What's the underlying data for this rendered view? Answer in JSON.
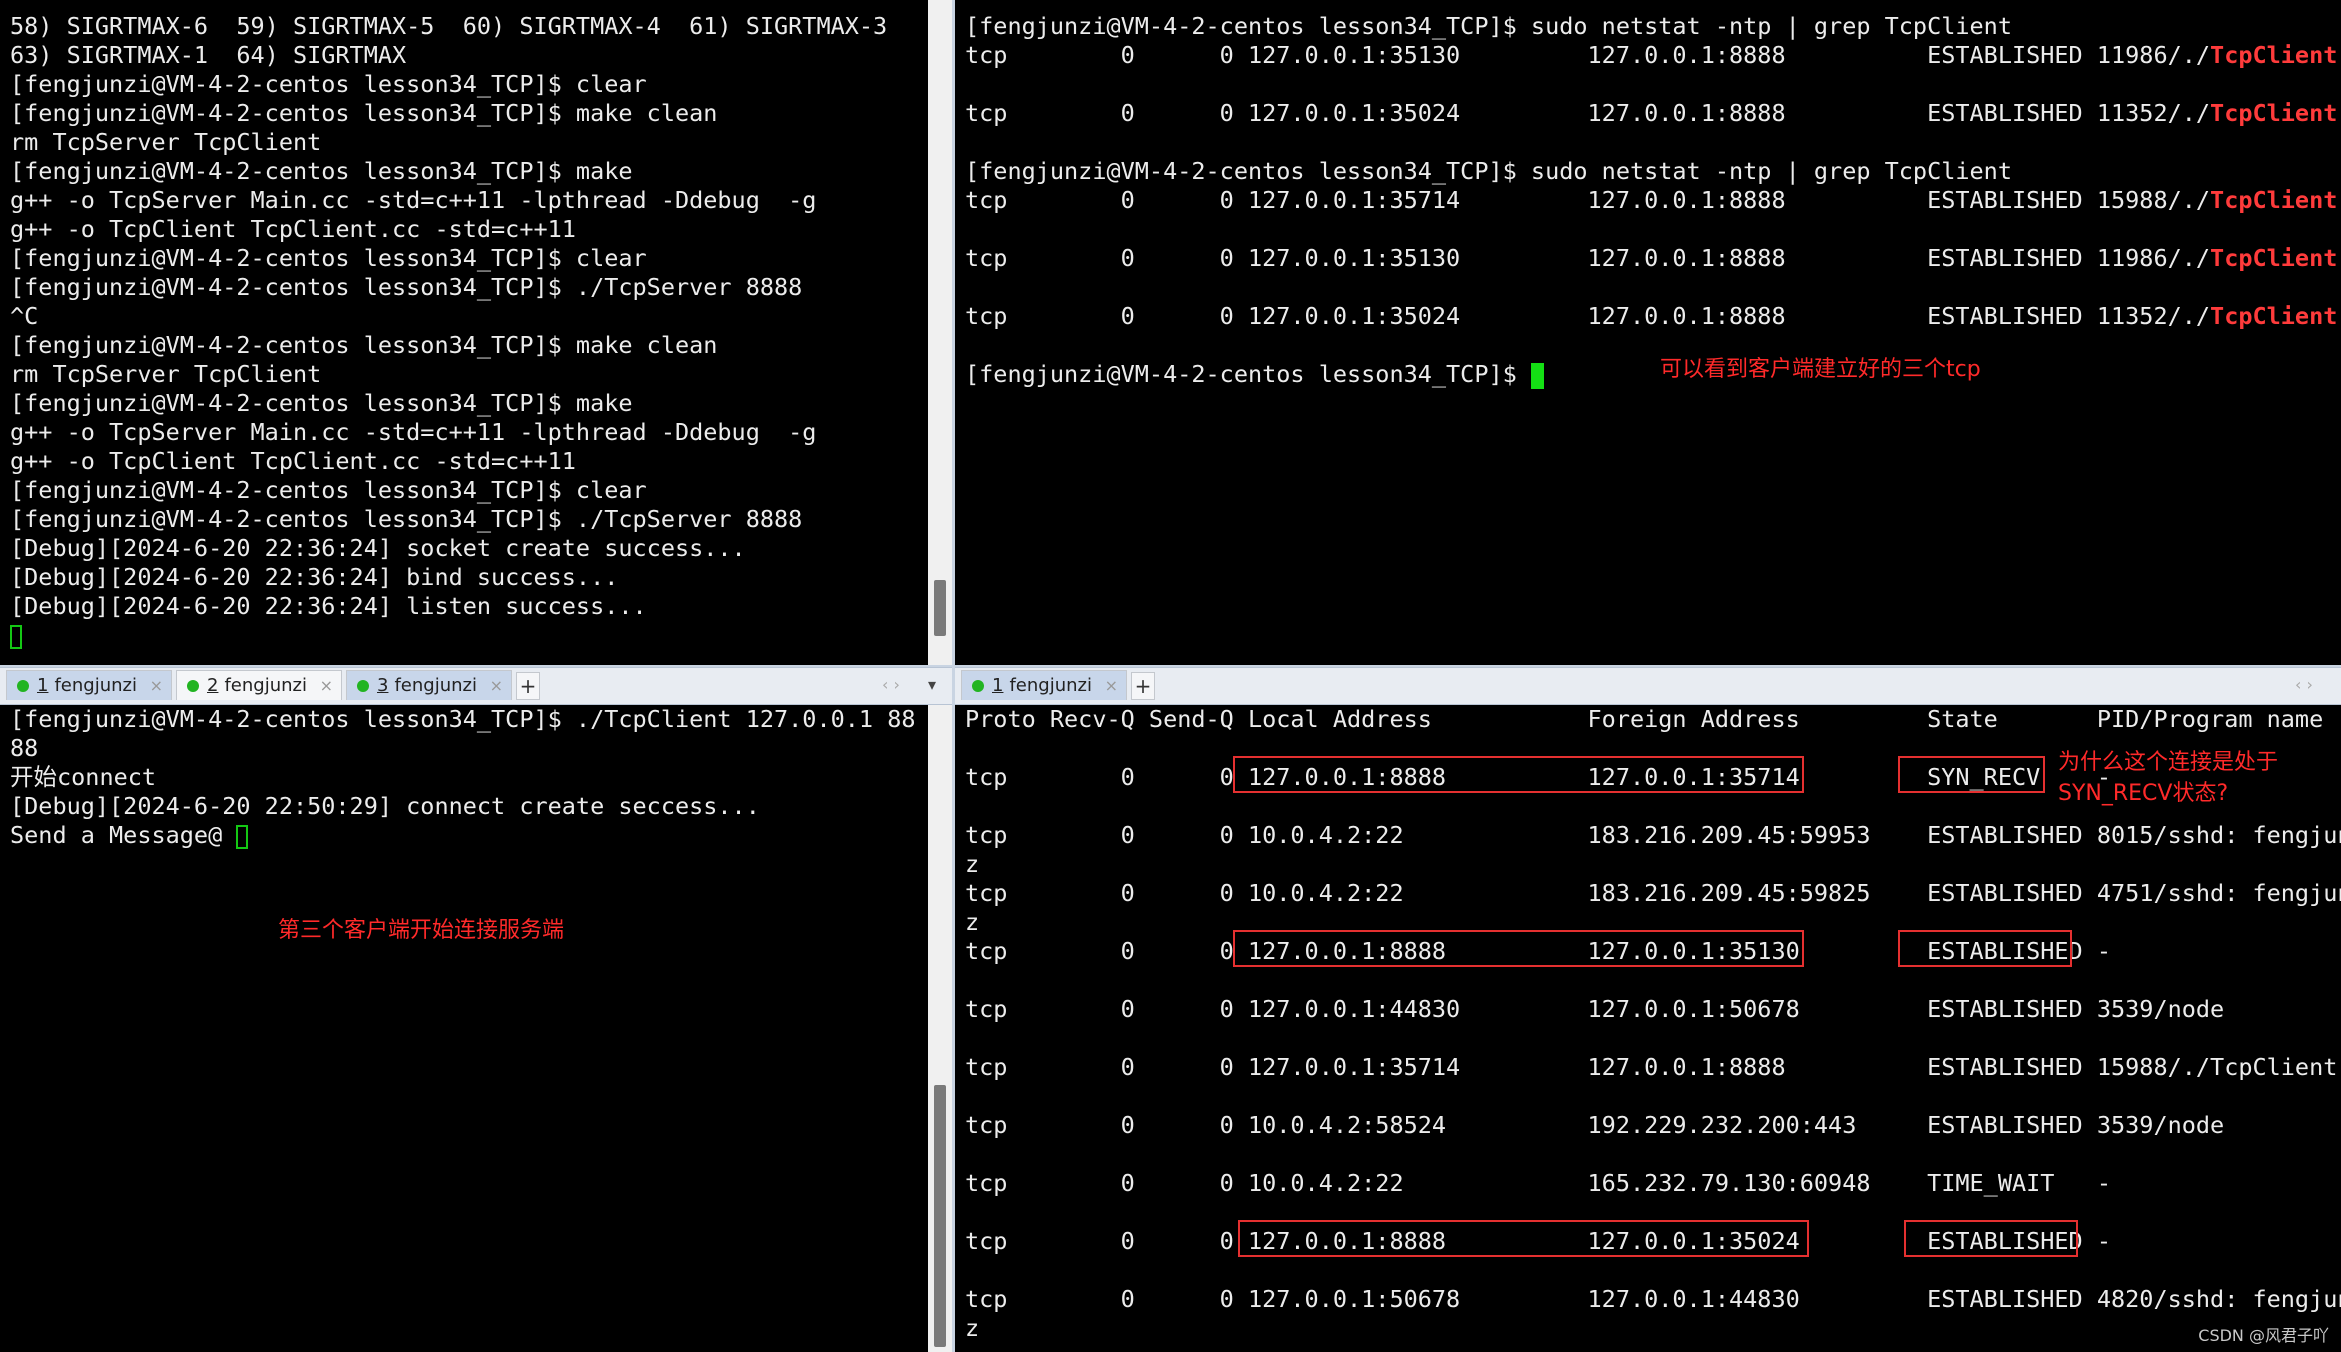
{
  "top_left": {
    "lines": [
      "58) SIGRTMAX-6  59) SIGRTMAX-5  60) SIGRTMAX-4  61) SIGRTMAX-3",
      "63) SIGRTMAX-1  64) SIGRTMAX",
      "[fengjunzi@VM-4-2-centos lesson34_TCP]$ clear",
      "[fengjunzi@VM-4-2-centos lesson34_TCP]$ make clean",
      "rm TcpServer TcpClient",
      "[fengjunzi@VM-4-2-centos lesson34_TCP]$ make",
      "g++ -o TcpServer Main.cc -std=c++11 -lpthread -Ddebug  -g",
      "g++ -o TcpClient TcpClient.cc -std=c++11",
      "[fengjunzi@VM-4-2-centos lesson34_TCP]$ clear",
      "[fengjunzi@VM-4-2-centos lesson34_TCP]$ ./TcpServer 8888",
      "^C",
      "[fengjunzi@VM-4-2-centos lesson34_TCP]$ make clean",
      "rm TcpServer TcpClient",
      "[fengjunzi@VM-4-2-centos lesson34_TCP]$ make",
      "g++ -o TcpServer Main.cc -std=c++11 -lpthread -Ddebug  -g",
      "g++ -o TcpClient TcpClient.cc -std=c++11",
      "[fengjunzi@VM-4-2-centos lesson34_TCP]$ clear",
      "[fengjunzi@VM-4-2-centos lesson34_TCP]$ ./TcpServer 8888",
      "[Debug][2024-6-20 22:36:24] socket create success...",
      "[Debug][2024-6-20 22:36:24] bind success...",
      "[Debug][2024-6-20 22:36:24] listen success..."
    ]
  },
  "top_right": {
    "l0": "[fengjunzi@VM-4-2-centos lesson34_TCP]$ sudo netstat -ntp | grep TcpClient",
    "l1": "tcp        0      0 127.0.0.1:35130         127.0.0.1:8888          ESTABLISHED 11986/./",
    "l3": "tcp        0      0 127.0.0.1:35024         127.0.0.1:8888          ESTABLISHED 11352/./",
    "l5": "[fengjunzi@VM-4-2-centos lesson34_TCP]$ sudo netstat -ntp | grep TcpClient",
    "l6": "tcp        0      0 127.0.0.1:35714         127.0.0.1:8888          ESTABLISHED 15988/./",
    "l8": "tcp        0      0 127.0.0.1:35130         127.0.0.1:8888          ESTABLISHED 11986/./",
    "l10": "tcp        0      0 127.0.0.1:35024         127.0.0.1:8888          ESTABLISHED 11352/./",
    "prompt": "[fengjunzi@VM-4-2-centos lesson34_TCP]$ ",
    "highlight": "TcpClient",
    "note": "可以看到客户端建立好的三个tcp"
  },
  "tabs_left": [
    {
      "num": "1",
      "label": "fengjunzi"
    },
    {
      "num": "2",
      "label": "fengjunzi"
    },
    {
      "num": "3",
      "label": "fengjunzi"
    }
  ],
  "tabs_right": [
    {
      "num": "1",
      "label": "fengjunzi"
    }
  ],
  "tab_close": "×",
  "tab_add": "+",
  "nav_arrows": "‹ ›",
  "nav_menu": "▾",
  "bottom_left": {
    "l0": "[fengjunzi@VM-4-2-centos lesson34_TCP]$ ./TcpClient 127.0.0.1 88",
    "l1": "88",
    "l2": "开始connect",
    "l3": "[Debug][2024-6-20 22:50:29] connect create seccess...",
    "l4": "Send a Message@ ",
    "note": "第三个客户端开始连接服务端"
  },
  "bottom_right": {
    "lines": [
      "Proto Recv-Q Send-Q Local Address           Foreign Address         State       PID/Program name",
      "",
      "tcp        0      0 127.0.0.1:8888          127.0.0.1:35714         SYN_RECV    -",
      "",
      "tcp        0      0 10.0.4.2:22             183.216.209.45:59953    ESTABLISHED 8015/sshd: fengjun",
      "z",
      "tcp        0      0 10.0.4.2:22             183.216.209.45:59825    ESTABLISHED 4751/sshd: fengjun",
      "z",
      "tcp        0      0 127.0.0.1:8888          127.0.0.1:35130         ESTABLISHED -",
      "",
      "tcp        0      0 127.0.0.1:44830         127.0.0.1:50678         ESTABLISHED 3539/node",
      "",
      "tcp        0      0 127.0.0.1:35714         127.0.0.1:8888          ESTABLISHED 15988/./TcpClient",
      "",
      "tcp        0      0 10.0.4.2:58524          192.229.232.200:443     ESTABLISHED 3539/node",
      "",
      "tcp        0      0 10.0.4.2:22             165.232.79.130:60948    TIME_WAIT   -",
      "",
      "tcp        0      0 127.0.0.1:8888          127.0.0.1:35024         ESTABLISHED -",
      "",
      "tcp        0      0 127.0.0.1:50678         127.0.0.1:44830         ESTABLISHED 4820/sshd: fengjun",
      "z"
    ],
    "note": "为什么这个连接是处于\nSYN_RECV状态?"
  },
  "watermark": "CSDN @风君子吖"
}
